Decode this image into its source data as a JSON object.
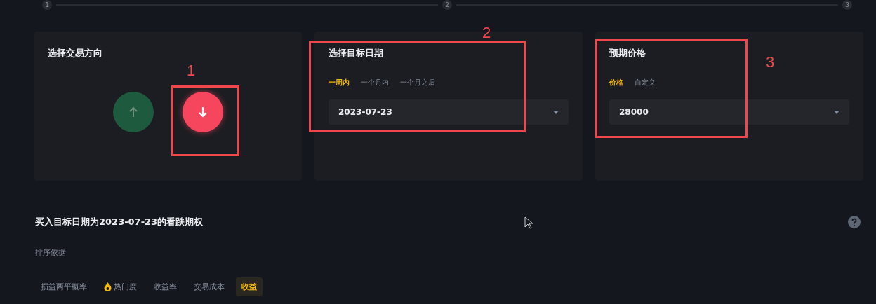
{
  "steps": [
    {
      "label": "1"
    },
    {
      "label": "2"
    },
    {
      "label": "3"
    }
  ],
  "direction_card": {
    "annotation": "1",
    "title": "选择交易方向",
    "options": [
      {
        "kind": "up",
        "selected": false
      },
      {
        "kind": "down",
        "selected": true
      }
    ]
  },
  "date_card": {
    "annotation": "2",
    "title": "选择目标日期",
    "tabs": [
      {
        "label": "一周内",
        "selected": true
      },
      {
        "label": "一个月内",
        "selected": false
      },
      {
        "label": "一个月之后",
        "selected": false
      }
    ],
    "select": {
      "value": "2023-07-23"
    }
  },
  "price_card": {
    "annotation": "3",
    "title": "预期价格",
    "tabs": [
      {
        "label": "价格",
        "selected": true
      },
      {
        "label": "自定义",
        "selected": false
      }
    ],
    "select": {
      "value": "28000"
    }
  },
  "result": {
    "heading": "买入目标日期为2023-07-23的看跌期权",
    "sort_label": "排序依据",
    "sort_options": [
      {
        "label": "损益两平概率",
        "kind": "plain",
        "selected": false
      },
      {
        "label": "热门度",
        "kind": "hot",
        "selected": false
      },
      {
        "label": "收益率",
        "kind": "plain",
        "selected": false
      },
      {
        "label": "交易成本",
        "kind": "plain",
        "selected": false
      },
      {
        "label": "收益",
        "kind": "plain",
        "selected": true
      }
    ]
  }
}
